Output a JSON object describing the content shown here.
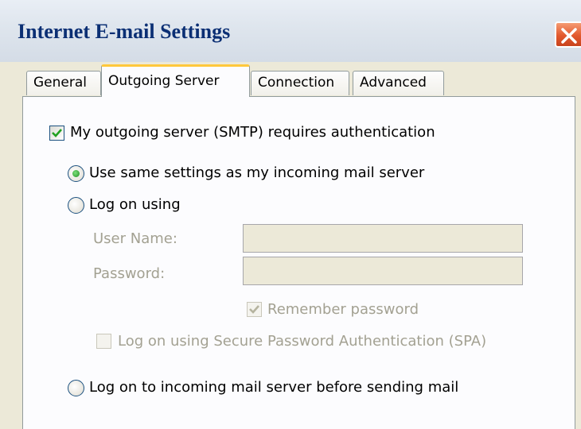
{
  "window": {
    "title": "Internet E-mail Settings"
  },
  "tabs": [
    {
      "label": "General"
    },
    {
      "label": "Outgoing Server"
    },
    {
      "label": "Connection"
    },
    {
      "label": "Advanced"
    }
  ],
  "smtp_auth": {
    "label": "My outgoing server (SMTP) requires authentication",
    "checked": true
  },
  "options": {
    "same_settings": {
      "label": "Use same settings as my incoming mail server",
      "selected": true
    },
    "log_on_using": {
      "label": "Log on using",
      "selected": false
    },
    "user_name": {
      "label": "User Name:",
      "value": ""
    },
    "password": {
      "label": "Password:",
      "value": ""
    },
    "remember_password": {
      "label": "Remember password",
      "checked": true,
      "enabled": false
    },
    "spa": {
      "label": "Log on using Secure Password Authentication (SPA)",
      "checked": false,
      "enabled": false
    },
    "log_on_incoming": {
      "label": "Log on to incoming mail server before sending mail",
      "selected": false
    }
  }
}
